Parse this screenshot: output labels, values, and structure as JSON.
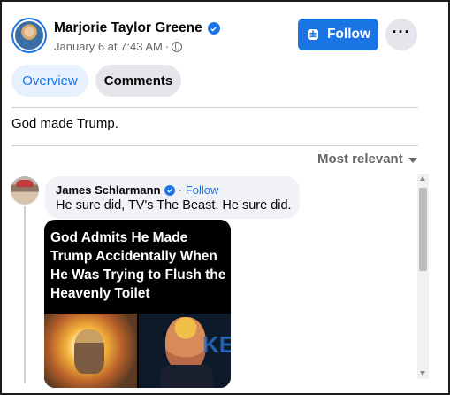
{
  "post": {
    "author": "Marjorie Taylor Greene",
    "timestamp": "January 6 at 7:43 AM",
    "meta_separator": "·",
    "follow_label": "Follow",
    "more_label": "···",
    "text": "God made Trump."
  },
  "tabs": [
    {
      "label": "Overview",
      "active": true
    },
    {
      "label": "Comments",
      "active": false
    }
  ],
  "sort": {
    "label": "Most relevant"
  },
  "comment": {
    "author": "James Schlarmann",
    "separator": "·",
    "follow_label": "Follow",
    "text": "He sure did, TV's The Beast. He sure did.",
    "image_caption": "God Admits He Made Trump Accidentally When He Was Trying to Flush the Heavenly Toilet",
    "image_logo_text": "KE"
  },
  "colors": {
    "accent": "#1b74e4",
    "secondary_text": "#65676b",
    "bubble": "#f0f2f5"
  },
  "icons": [
    "verified-badge-icon",
    "globe-icon",
    "follow-icon",
    "more-icon",
    "caret-down-icon"
  ]
}
